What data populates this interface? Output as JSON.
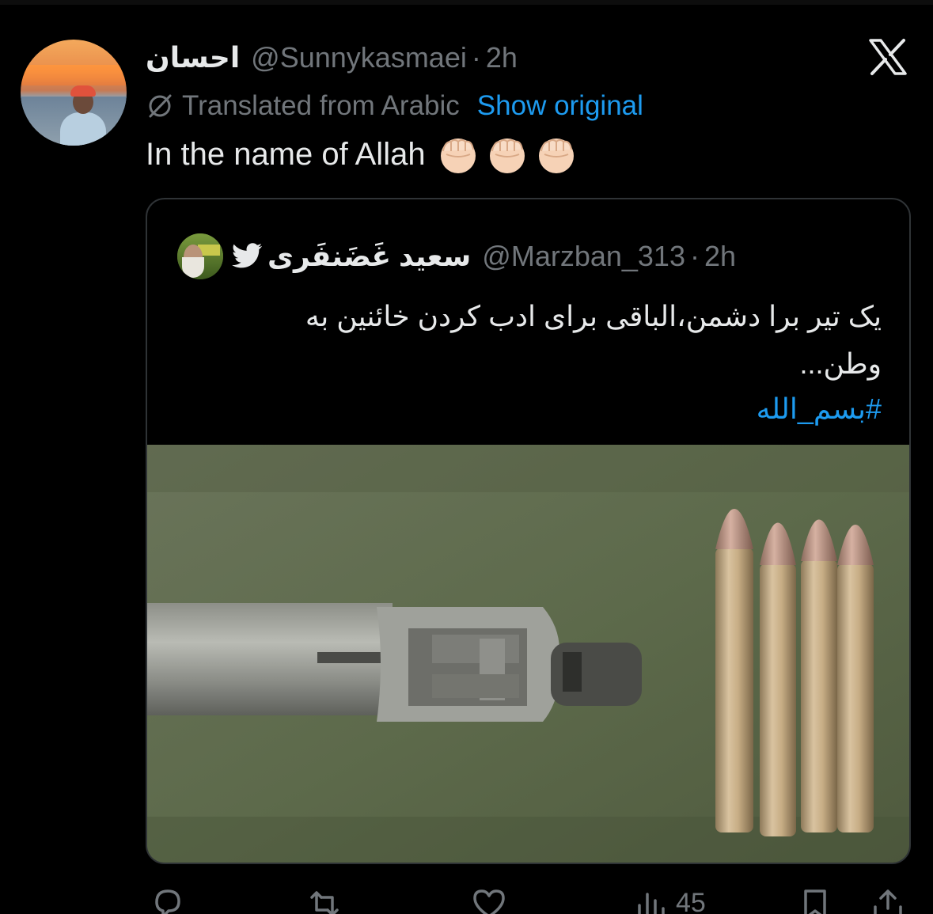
{
  "tweet": {
    "display_name": "احسان",
    "handle": "@Sunnykasmaei",
    "separator": "·",
    "time": "2h",
    "translated_label": "Translated from Arabic",
    "show_original_label": "Show original",
    "text": "In the name of Allah",
    "emoji": [
      "raised-fist",
      "raised-fist",
      "raised-fist"
    ]
  },
  "quoted": {
    "display_name": "سعید غَضَنفَری",
    "handle": "@Marzban_313",
    "separator": "·",
    "time": "2h",
    "lines": [
      "یک تیر برا دشمن،الباقی برای ادب کردن خائنین به",
      "وطن..."
    ],
    "hashtag": "#بسم_الله",
    "image_description_icon": "photo"
  },
  "actions": {
    "reply_icon": "reply-icon",
    "retweet_icon": "retweet-icon",
    "like_icon": "heart-icon",
    "views_icon": "views-icon",
    "views_count": "45",
    "bookmark_icon": "bookmark-icon",
    "share_icon": "share-icon"
  },
  "colors": {
    "background": "#000000",
    "text": "#e7e9ea",
    "muted": "#71767b",
    "link": "#1d9bf0",
    "border": "#2f3336"
  }
}
